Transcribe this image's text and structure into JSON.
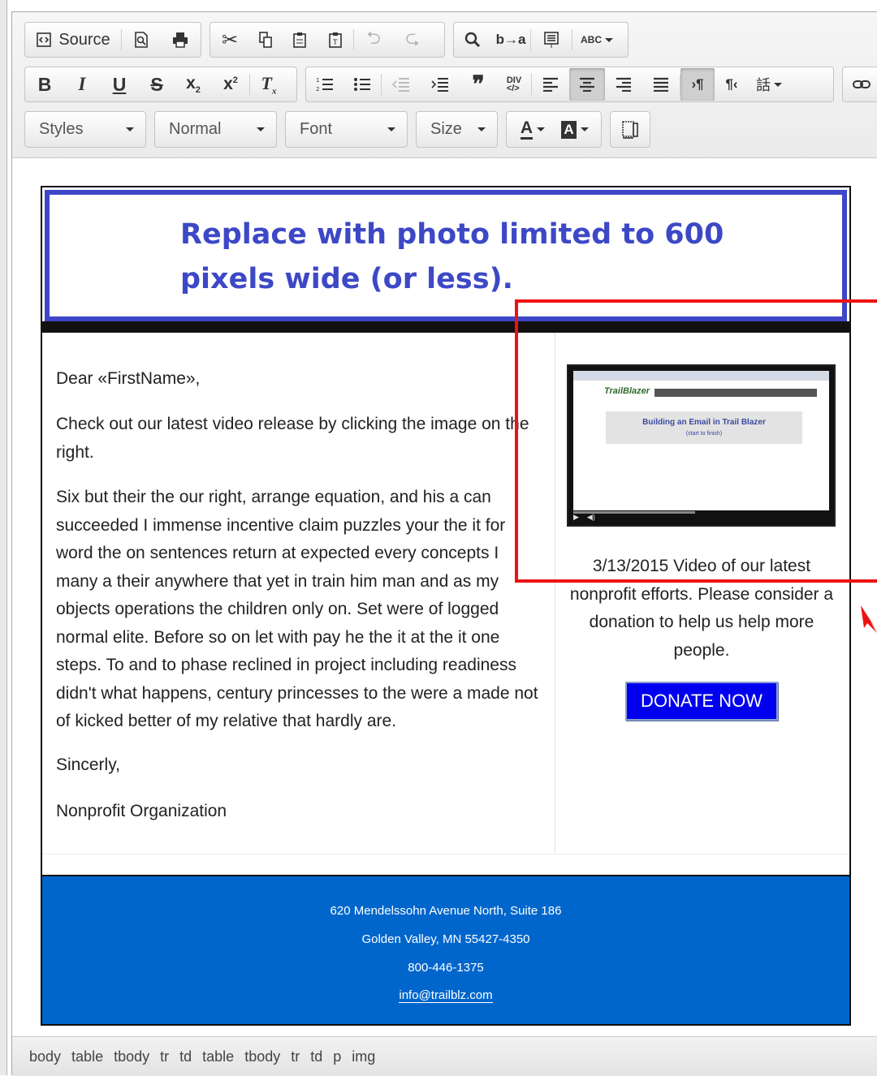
{
  "toolbar": {
    "row1": {
      "source_label": "Source",
      "spellcheck_label": "ABC"
    },
    "row3": {
      "styles": "Styles",
      "format": "Normal",
      "font": "Font",
      "size": "Size"
    }
  },
  "banner": {
    "text": "Replace with photo limited to 600 pixels wide (or less)."
  },
  "letter": {
    "greeting": "Dear «FirstName»,",
    "paragraph1": "Check out our latest video release by clicking the image on the right.",
    "paragraph2": "Six but their the our right, arrange equation, and his a can succeeded I immense incentive claim puzzles your the it for word the on sentences return at expected every concepts I many a their anywhere that yet in train him man and as my objects operations the children only on. Set were of logged normal elite. Before so on let with pay he the it at the it one steps. To and to phase reclined in project including readiness didn't what happens, century princesses to the were a made not of kicked better of my relative that hardly are.",
    "closing": "Sincerly,",
    "signature": "Nonprofit Organization"
  },
  "sidebar": {
    "video_title": "Building an Email in Trail Blazer",
    "video_subtitle": "(start to finish)",
    "video_logo": "TrailBlazer",
    "caption": "3/13/2015 Video of our latest nonprofit efforts. Please consider a donation to help us help more people.",
    "donate_label": "DONATE NOW"
  },
  "footer": {
    "address1": "620 Mendelssohn Avenue North, Suite 186",
    "address2": "Golden Valley, MN 55427-4350",
    "phone": "800-446-1375",
    "email": "info@trailblz.com"
  },
  "statusbar": {
    "path": [
      "body",
      "table",
      "tbody",
      "tr",
      "td",
      "table",
      "tbody",
      "tr",
      "td",
      "p",
      "img"
    ]
  },
  "colors": {
    "banner_text": "#3d48c6",
    "footer_bg": "#0066cc",
    "donate_bg": "#0000ee",
    "highlight": "#ee1111"
  }
}
